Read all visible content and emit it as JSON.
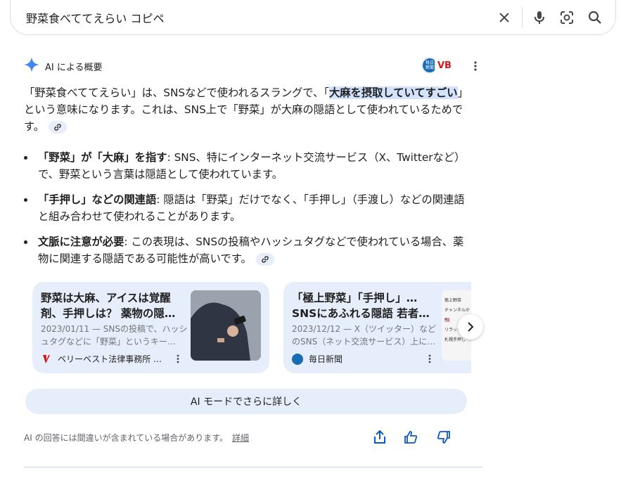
{
  "search": {
    "query": "野菜食べててえらい コピペ",
    "clear_icon": "close-icon",
    "voice_icon": "mic-icon",
    "lens_icon": "camera-lens-icon",
    "search_icon": "search-icon"
  },
  "overview": {
    "label": "AI による概要",
    "source_logos": [
      "毎日新聞",
      "VB"
    ],
    "paragraph": {
      "part1": "「野菜食べててえらい」は、SNSなどで使われるスラングで、「",
      "highlight": "大麻を摂取していてすごい",
      "part2": "」という意味になります。これは、SNS上で「野菜」が大麻の隠語として使われているためです。"
    },
    "bullets": [
      {
        "bold": "「野菜」が「大麻」を指す",
        "text": ": SNS、特にインターネット交流サービス（X、Twitterなど）で、野菜という言葉は隠語として使われています。"
      },
      {
        "bold": "「手押し」などの関連語",
        "text": ": 隠語は「野菜」だけでなく、「手押し」（手渡し）などの関連語と組み合わせて使われることがあります。"
      },
      {
        "bold": "文脈に注意が必要",
        "text": ": この表現は、SNSの投稿やハッシュタグなどで使われている場合、薬物に関連する隠語である可能性が高いです。"
      }
    ]
  },
  "cards": [
    {
      "title_line1": "野菜は大麻、アイスは覚醒",
      "title_line2": "剤、手押しは？ 薬物の隠…",
      "snippet_line1": "2023/01/11 — SNSの投稿で、ハッシ",
      "snippet_line2": "ュタグなどに「野菜」というキー…",
      "source": "ベリーベスト法律事務所 …"
    },
    {
      "title_line1": "「極上野菜」「手押し」…",
      "title_line2": "SNSにあふれる隠語 若者…",
      "snippet_line1": "2023/12/12 — X（ツイッター）など",
      "snippet_line2": "のSNS（ネット交流サービス）上に…",
      "source": "毎日新聞",
      "thumb_lines": [
        "極上野菜",
        "チャンネルか",
        "🇺🇸",
        "リラックス",
        "札幌手押し"
      ]
    }
  ],
  "ai_mode_label": "AI モードでさらに詳しく",
  "footer": {
    "disclaimer": "AI の回答には間違いが含まれている場合があります。",
    "detail_link": "詳細"
  },
  "colors": {
    "accent": "#0b57d0",
    "card_bg": "#e7eefb",
    "highlight": "#d3e3fd"
  }
}
